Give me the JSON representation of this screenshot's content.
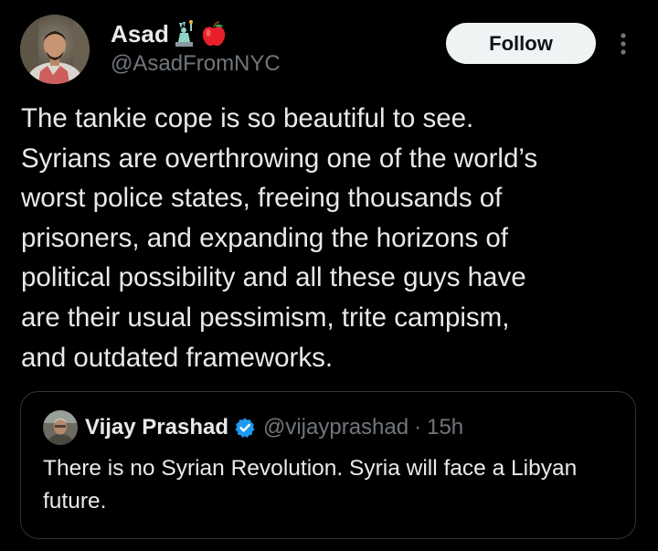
{
  "colors": {
    "background": "#000000",
    "text_primary": "#e7e9ea",
    "text_secondary": "#71767b",
    "follow_bg": "#eff3f4",
    "verified": "#1d9bf0",
    "quote_border": "#2f3336"
  },
  "author": {
    "display_name": "Asad",
    "name_emojis": [
      "statue-of-liberty-emoji",
      "red-apple-emoji"
    ],
    "handle": "@AsadFromNYC",
    "avatar": "user-avatar"
  },
  "actions": {
    "follow_label": "Follow",
    "more_icon": "more-vertical-icon"
  },
  "tweet": {
    "text": "The tankie cope is so beautiful to see.\nSyrians are overthrowing one of the world’s\nworst police states, freeing thousands of\nprisoners, and expanding the horizons of\npolitical possibility and all these guys have\nare their usual pessimism, trite campism,\nand outdated frameworks."
  },
  "quoted_tweet": {
    "display_name": "Vijay Prashad",
    "verified_icon": "verified-badge-icon",
    "handle": "@vijayprashad",
    "separator": "·",
    "time": "15h",
    "text": "There is no Syrian Revolution. Syria will face a Libyan future."
  }
}
